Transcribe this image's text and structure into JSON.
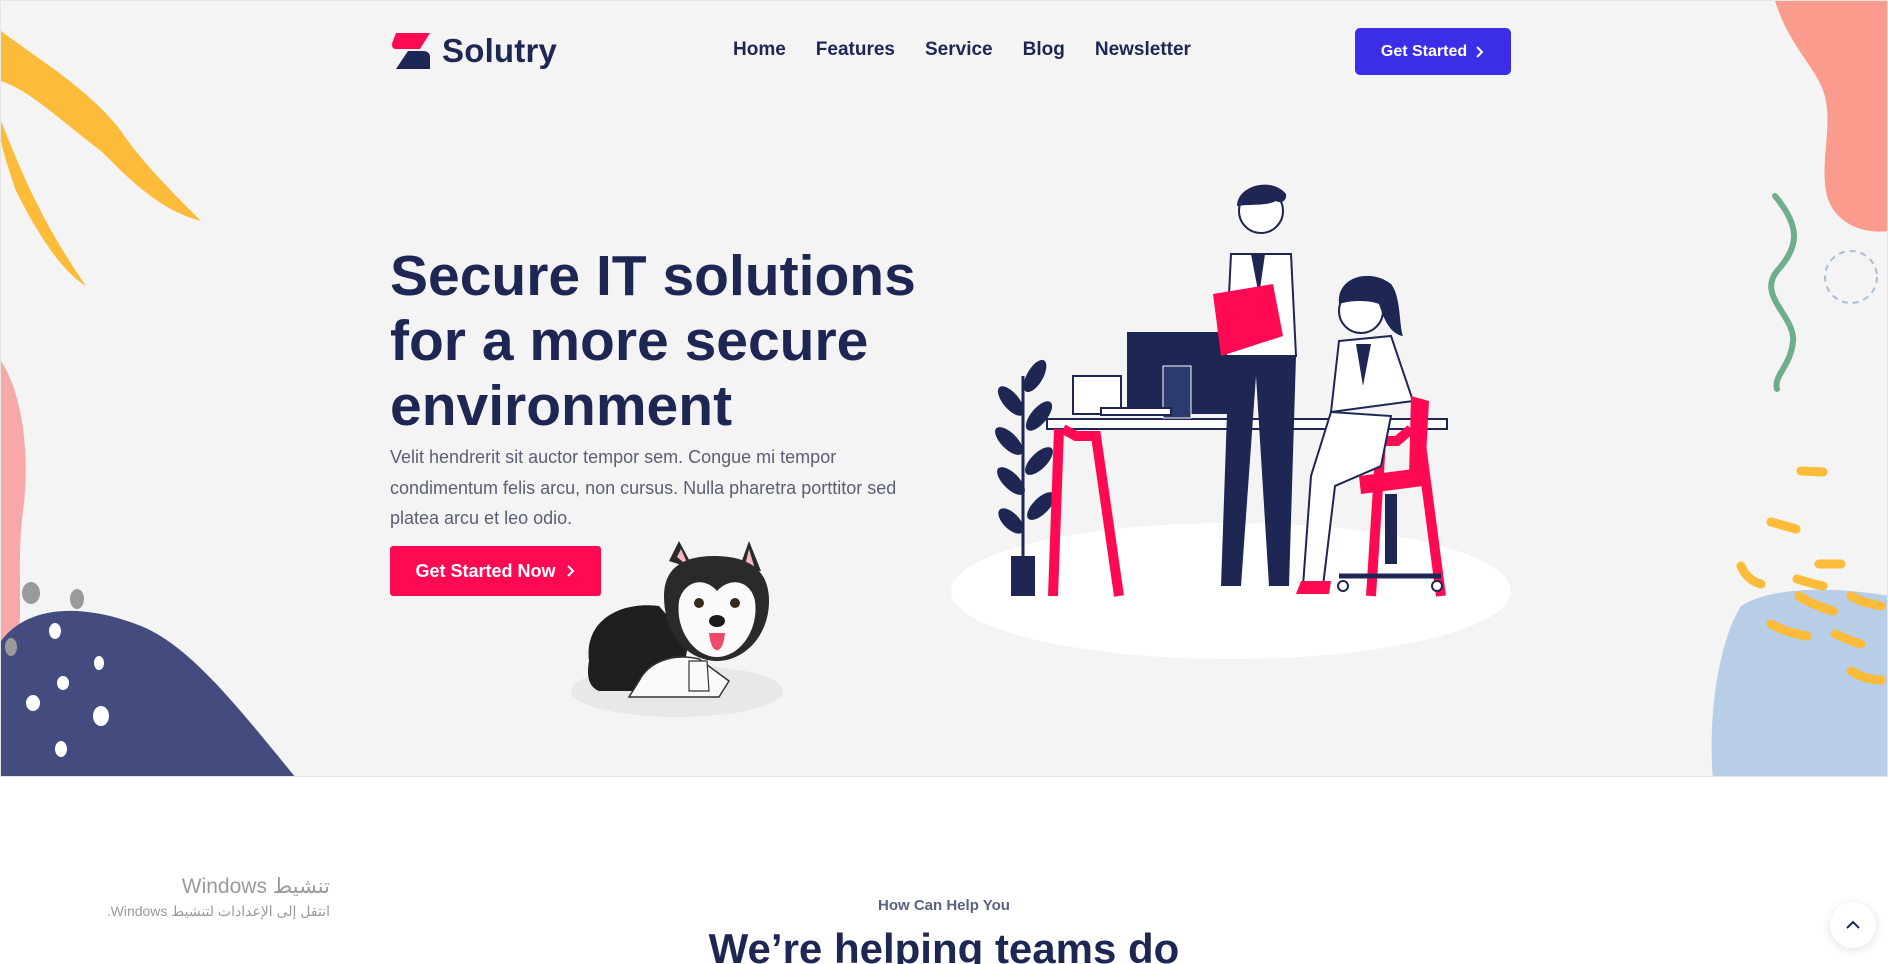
{
  "brand": {
    "name": "Solutry"
  },
  "nav": {
    "items": [
      {
        "label": "Home"
      },
      {
        "label": "Features"
      },
      {
        "label": "Service"
      },
      {
        "label": "Blog"
      },
      {
        "label": "Newsletter"
      }
    ],
    "cta_label": "Get Started"
  },
  "hero": {
    "title": "Secure IT solutions for a more secure environment",
    "description": "Velit hendrerit sit auctor tempor sem. Congue mi tempor condimentum felis arcu, non cursus. Nulla pharetra porttitor sed platea arcu et leo odio.",
    "cta_label": "Get Started Now"
  },
  "section": {
    "eyebrow": "How Can Help You",
    "title": "We’re helping teams do"
  },
  "os_watermark": {
    "line1": "تنشيط Windows",
    "line2": "انتقل إلى الإعدادات لتنشيط Windows."
  },
  "colors": {
    "primary_navy": "#1e2654",
    "accent_red": "#ff0a52",
    "accent_blue": "#3b2ee8",
    "hero_bg": "#f4f4f4"
  },
  "icons": [
    "chevron-right-icon",
    "chevron-up-icon",
    "logo-mark-icon"
  ]
}
